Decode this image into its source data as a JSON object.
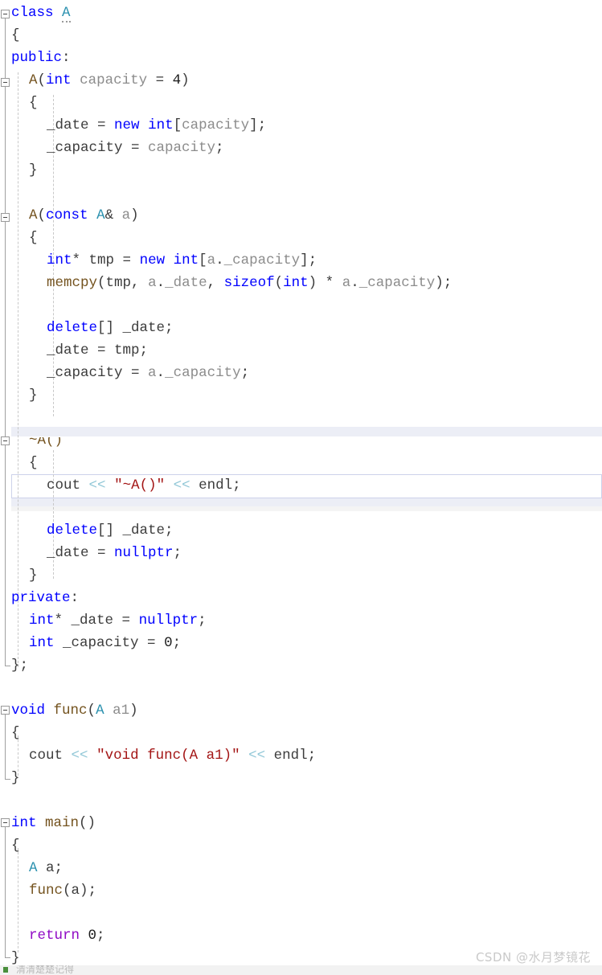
{
  "app": {
    "kind": "code-editor",
    "language": "C++",
    "theme_background": "#ffffff"
  },
  "colors": {
    "keyword": "#0000ff",
    "type": "#2b91af",
    "class_name": "#2b91af",
    "identifier": "#8c8c8c",
    "string": "#a31515",
    "operator_stream": "#8fc6d6",
    "control_keyword": "#8f08c4",
    "function": "#74531f",
    "plain_text": "#3c3c3c",
    "current_line_border": "#cdd2ea",
    "band": "#eceef6",
    "gutter_line": "#a0a0a0",
    "indent_guide": "#c8c8c8",
    "watermark": "#c9c9c9"
  },
  "watermark": {
    "text": "CSDN @水月梦镜花"
  },
  "status_fragment": {
    "text": "清清楚楚记得"
  },
  "current_line": {
    "index": 21,
    "text": "cout << \"~A()\" << endl;"
  },
  "fold_markers": [
    {
      "line": 0,
      "state": "expanded",
      "label": "class A"
    },
    {
      "line": 3,
      "state": "expanded",
      "label": "A(int capacity = 4)"
    },
    {
      "line": 9,
      "state": "expanded",
      "label": "A(const A& a)"
    },
    {
      "line": 19,
      "state": "expanded",
      "label": "~A()"
    },
    {
      "line": 31,
      "state": "expanded",
      "label": "void func(A a1)"
    },
    {
      "line": 36,
      "state": "expanded",
      "label": "int main()"
    }
  ],
  "code": {
    "lines": [
      {
        "n": 0,
        "indent": 0,
        "tokens": [
          {
            "t": "class",
            "c": "kw"
          },
          {
            "t": " ",
            "c": "plain"
          },
          {
            "t": "A",
            "c": "cls squig"
          }
        ]
      },
      {
        "n": 1,
        "indent": 0,
        "tokens": [
          {
            "t": "{",
            "c": "punc"
          }
        ]
      },
      {
        "n": 2,
        "indent": 0,
        "tokens": [
          {
            "t": "public",
            "c": "kw"
          },
          {
            "t": ":",
            "c": "punc"
          }
        ]
      },
      {
        "n": 3,
        "indent": 1,
        "tokens": [
          {
            "t": "A",
            "c": "fn"
          },
          {
            "t": "(",
            "c": "punc"
          },
          {
            "t": "int",
            "c": "kw"
          },
          {
            "t": " ",
            "c": "plain"
          },
          {
            "t": "capacity",
            "c": "id"
          },
          {
            "t": " = ",
            "c": "plain"
          },
          {
            "t": "4",
            "c": "num"
          },
          {
            "t": ")",
            "c": "punc"
          }
        ]
      },
      {
        "n": 4,
        "indent": 1,
        "tokens": [
          {
            "t": "{",
            "c": "punc"
          }
        ]
      },
      {
        "n": 5,
        "indent": 2,
        "tokens": [
          {
            "t": "_date",
            "c": "plain"
          },
          {
            "t": " = ",
            "c": "plain"
          },
          {
            "t": "new",
            "c": "kw"
          },
          {
            "t": " ",
            "c": "plain"
          },
          {
            "t": "int",
            "c": "kw"
          },
          {
            "t": "[",
            "c": "punc"
          },
          {
            "t": "capacity",
            "c": "id"
          },
          {
            "t": "];",
            "c": "punc"
          }
        ]
      },
      {
        "n": 6,
        "indent": 2,
        "tokens": [
          {
            "t": "_capacity",
            "c": "plain"
          },
          {
            "t": " = ",
            "c": "plain"
          },
          {
            "t": "capacity",
            "c": "id"
          },
          {
            "t": ";",
            "c": "punc"
          }
        ]
      },
      {
        "n": 7,
        "indent": 1,
        "tokens": [
          {
            "t": "}",
            "c": "punc"
          }
        ]
      },
      {
        "n": 8,
        "indent": 0,
        "tokens": []
      },
      {
        "n": 9,
        "indent": 1,
        "tokens": [
          {
            "t": "A",
            "c": "fn"
          },
          {
            "t": "(",
            "c": "punc"
          },
          {
            "t": "const",
            "c": "kw"
          },
          {
            "t": " ",
            "c": "plain"
          },
          {
            "t": "A",
            "c": "cls"
          },
          {
            "t": "& ",
            "c": "punc"
          },
          {
            "t": "a",
            "c": "id"
          },
          {
            "t": ")",
            "c": "punc"
          }
        ]
      },
      {
        "n": 10,
        "indent": 1,
        "tokens": [
          {
            "t": "{",
            "c": "punc"
          }
        ]
      },
      {
        "n": 11,
        "indent": 2,
        "tokens": [
          {
            "t": "int",
            "c": "kw"
          },
          {
            "t": "* ",
            "c": "punc"
          },
          {
            "t": "tmp",
            "c": "plain"
          },
          {
            "t": " = ",
            "c": "plain"
          },
          {
            "t": "new",
            "c": "kw"
          },
          {
            "t": " ",
            "c": "plain"
          },
          {
            "t": "int",
            "c": "kw"
          },
          {
            "t": "[",
            "c": "punc"
          },
          {
            "t": "a",
            "c": "id"
          },
          {
            "t": ".",
            "c": "punc"
          },
          {
            "t": "_capacity",
            "c": "id"
          },
          {
            "t": "];",
            "c": "punc"
          }
        ]
      },
      {
        "n": 12,
        "indent": 2,
        "tokens": [
          {
            "t": "memcpy",
            "c": "fn"
          },
          {
            "t": "(",
            "c": "punc"
          },
          {
            "t": "tmp",
            "c": "plain"
          },
          {
            "t": ", ",
            "c": "punc"
          },
          {
            "t": "a",
            "c": "id"
          },
          {
            "t": ".",
            "c": "punc"
          },
          {
            "t": "_date",
            "c": "id"
          },
          {
            "t": ", ",
            "c": "punc"
          },
          {
            "t": "sizeof",
            "c": "kw"
          },
          {
            "t": "(",
            "c": "punc"
          },
          {
            "t": "int",
            "c": "kw"
          },
          {
            "t": ") * ",
            "c": "punc"
          },
          {
            "t": "a",
            "c": "id"
          },
          {
            "t": ".",
            "c": "punc"
          },
          {
            "t": "_capacity",
            "c": "id"
          },
          {
            "t": ");",
            "c": "punc"
          }
        ]
      },
      {
        "n": 13,
        "indent": 0,
        "tokens": []
      },
      {
        "n": 14,
        "indent": 2,
        "tokens": [
          {
            "t": "delete",
            "c": "kw"
          },
          {
            "t": "[] ",
            "c": "punc"
          },
          {
            "t": "_date",
            "c": "plain"
          },
          {
            "t": ";",
            "c": "punc"
          }
        ]
      },
      {
        "n": 15,
        "indent": 2,
        "tokens": [
          {
            "t": "_date",
            "c": "plain"
          },
          {
            "t": " = ",
            "c": "plain"
          },
          {
            "t": "tmp",
            "c": "plain"
          },
          {
            "t": ";",
            "c": "punc"
          }
        ]
      },
      {
        "n": 16,
        "indent": 2,
        "tokens": [
          {
            "t": "_capacity",
            "c": "plain"
          },
          {
            "t": " = ",
            "c": "plain"
          },
          {
            "t": "a",
            "c": "id"
          },
          {
            "t": ".",
            "c": "punc"
          },
          {
            "t": "_capacity",
            "c": "id"
          },
          {
            "t": ";",
            "c": "punc"
          }
        ]
      },
      {
        "n": 17,
        "indent": 1,
        "tokens": [
          {
            "t": "}",
            "c": "punc"
          }
        ]
      },
      {
        "n": 18,
        "indent": 0,
        "tokens": []
      },
      {
        "n": 19,
        "indent": 1,
        "tokens": [
          {
            "t": "~A()",
            "c": "fn"
          }
        ],
        "clipped": true
      },
      {
        "n": 20,
        "indent": 1,
        "tokens": [
          {
            "t": "{",
            "c": "punc"
          }
        ]
      },
      {
        "n": 21,
        "indent": 2,
        "tokens": [
          {
            "t": "cout",
            "c": "plain"
          },
          {
            "t": " ",
            "c": "plain"
          },
          {
            "t": "<<",
            "c": "op"
          },
          {
            "t": " ",
            "c": "plain"
          },
          {
            "t": "\"~A()\"",
            "c": "str"
          },
          {
            "t": " ",
            "c": "plain"
          },
          {
            "t": "<<",
            "c": "op"
          },
          {
            "t": " ",
            "c": "plain"
          },
          {
            "t": "endl",
            "c": "plain"
          },
          {
            "t": ";",
            "c": "punc"
          }
        ]
      },
      {
        "n": 22,
        "indent": 0,
        "tokens": []
      },
      {
        "n": 23,
        "indent": 2,
        "tokens": [
          {
            "t": "delete",
            "c": "kw"
          },
          {
            "t": "[] ",
            "c": "punc"
          },
          {
            "t": "_date",
            "c": "plain"
          },
          {
            "t": ";",
            "c": "punc"
          }
        ]
      },
      {
        "n": 24,
        "indent": 2,
        "tokens": [
          {
            "t": "_date",
            "c": "plain"
          },
          {
            "t": " = ",
            "c": "plain"
          },
          {
            "t": "nullptr",
            "c": "kw"
          },
          {
            "t": ";",
            "c": "punc"
          }
        ]
      },
      {
        "n": 25,
        "indent": 1,
        "tokens": [
          {
            "t": "}",
            "c": "punc"
          }
        ]
      },
      {
        "n": 26,
        "indent": 0,
        "tokens": [
          {
            "t": "private",
            "c": "kw"
          },
          {
            "t": ":",
            "c": "punc"
          }
        ]
      },
      {
        "n": 27,
        "indent": 1,
        "tokens": [
          {
            "t": "int",
            "c": "kw"
          },
          {
            "t": "* ",
            "c": "punc"
          },
          {
            "t": "_date",
            "c": "plain"
          },
          {
            "t": " = ",
            "c": "plain"
          },
          {
            "t": "nullptr",
            "c": "kw"
          },
          {
            "t": ";",
            "c": "punc"
          }
        ]
      },
      {
        "n": 28,
        "indent": 1,
        "tokens": [
          {
            "t": "int",
            "c": "kw"
          },
          {
            "t": " ",
            "c": "plain"
          },
          {
            "t": "_capacity",
            "c": "plain"
          },
          {
            "t": " = ",
            "c": "plain"
          },
          {
            "t": "0",
            "c": "num"
          },
          {
            "t": ";",
            "c": "punc"
          }
        ]
      },
      {
        "n": 29,
        "indent": 0,
        "tokens": [
          {
            "t": "};",
            "c": "punc"
          }
        ]
      },
      {
        "n": 30,
        "indent": 0,
        "tokens": []
      },
      {
        "n": 31,
        "indent": 0,
        "tokens": [
          {
            "t": "void",
            "c": "kw"
          },
          {
            "t": " ",
            "c": "plain"
          },
          {
            "t": "func",
            "c": "fn"
          },
          {
            "t": "(",
            "c": "punc"
          },
          {
            "t": "A",
            "c": "cls"
          },
          {
            "t": " ",
            "c": "plain"
          },
          {
            "t": "a1",
            "c": "id"
          },
          {
            "t": ")",
            "c": "punc"
          }
        ]
      },
      {
        "n": 32,
        "indent": 0,
        "tokens": [
          {
            "t": "{",
            "c": "punc"
          }
        ]
      },
      {
        "n": 33,
        "indent": 1,
        "tokens": [
          {
            "t": "cout",
            "c": "plain"
          },
          {
            "t": " ",
            "c": "plain"
          },
          {
            "t": "<<",
            "c": "op"
          },
          {
            "t": " ",
            "c": "plain"
          },
          {
            "t": "\"void func(A a1)\"",
            "c": "str"
          },
          {
            "t": " ",
            "c": "plain"
          },
          {
            "t": "<<",
            "c": "op"
          },
          {
            "t": " ",
            "c": "plain"
          },
          {
            "t": "endl",
            "c": "plain"
          },
          {
            "t": ";",
            "c": "punc"
          }
        ]
      },
      {
        "n": 34,
        "indent": 0,
        "tokens": [
          {
            "t": "}",
            "c": "punc"
          }
        ]
      },
      {
        "n": 35,
        "indent": 0,
        "tokens": []
      },
      {
        "n": 36,
        "indent": 0,
        "tokens": [
          {
            "t": "int",
            "c": "kw"
          },
          {
            "t": " ",
            "c": "plain"
          },
          {
            "t": "main",
            "c": "fn"
          },
          {
            "t": "()",
            "c": "punc"
          }
        ]
      },
      {
        "n": 37,
        "indent": 0,
        "tokens": [
          {
            "t": "{",
            "c": "punc"
          }
        ]
      },
      {
        "n": 38,
        "indent": 1,
        "tokens": [
          {
            "t": "A",
            "c": "cls"
          },
          {
            "t": " ",
            "c": "plain"
          },
          {
            "t": "a",
            "c": "plain"
          },
          {
            "t": ";",
            "c": "punc"
          }
        ]
      },
      {
        "n": 39,
        "indent": 1,
        "tokens": [
          {
            "t": "func",
            "c": "fn"
          },
          {
            "t": "(",
            "c": "punc"
          },
          {
            "t": "a",
            "c": "plain"
          },
          {
            "t": ");",
            "c": "punc"
          }
        ]
      },
      {
        "n": 40,
        "indent": 0,
        "tokens": []
      },
      {
        "n": 41,
        "indent": 1,
        "tokens": [
          {
            "t": "return",
            "c": "ctl"
          },
          {
            "t": " ",
            "c": "plain"
          },
          {
            "t": "0",
            "c": "num"
          },
          {
            "t": ";",
            "c": "punc"
          }
        ]
      },
      {
        "n": 42,
        "indent": 0,
        "tokens": [
          {
            "t": "}",
            "c": "punc"
          }
        ]
      }
    ]
  }
}
